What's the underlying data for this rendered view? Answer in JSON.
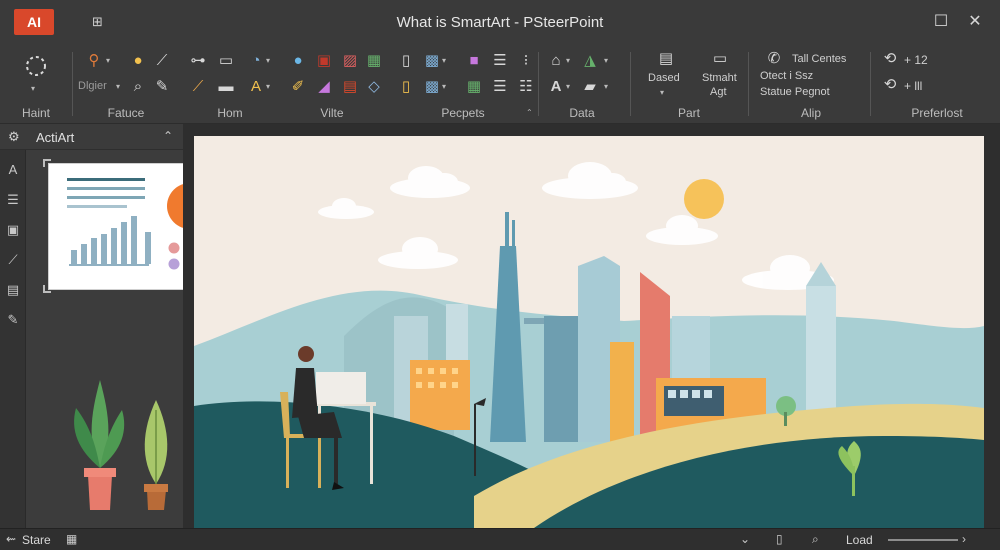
{
  "app": {
    "logo_text": "AI",
    "title": "What is SmartArt - PSteerPoint"
  },
  "ribbon": {
    "groups": [
      {
        "label": "Haint"
      },
      {
        "label": "Fatuce"
      },
      {
        "label": "Hom"
      },
      {
        "label": "Vilte"
      },
      {
        "label": "Pecpets"
      },
      {
        "label": "Data"
      },
      {
        "label": "Part"
      },
      {
        "label": "Alip"
      },
      {
        "label": "Preferlost"
      }
    ],
    "fatuce_dropdown": "Dlgier",
    "part": {
      "btn1": "Dased",
      "btn2": "Stmaht",
      "btn2b": "Agt"
    },
    "alip": {
      "line1": "Tall Centes",
      "line2": "Otect i Ssz",
      "line3": "Statue Pegnot"
    },
    "preferlost": {
      "line1": "+ 12",
      "line2": "+ lll"
    }
  },
  "panel": {
    "title": "ActiArt"
  },
  "status": {
    "left_label": "Stare",
    "right_label": "Load"
  },
  "colors": {
    "accent": "#d9482b",
    "slide_bg": "#f3ebe3",
    "hill_dark": "#1f5a5f",
    "sun": "#f6c25a"
  }
}
